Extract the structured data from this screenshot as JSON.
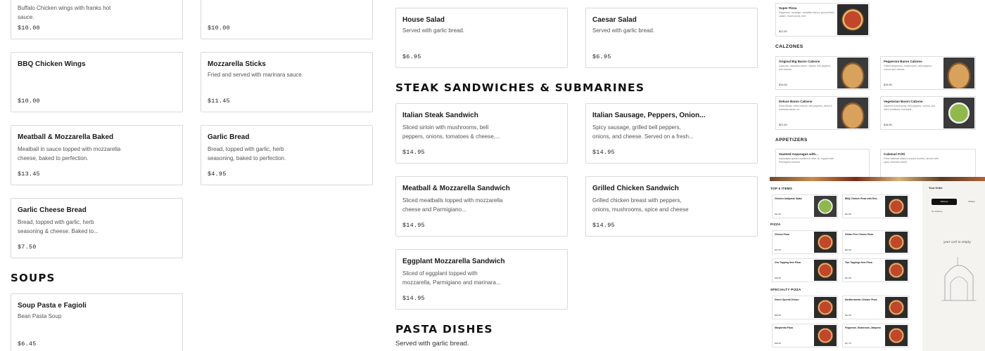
{
  "col1": {
    "cards": [
      {
        "name": "",
        "desc": "Buffalo Chicken wings with franks hot sauce.",
        "price": "$10.00"
      },
      {
        "name": "BBQ Chicken Wings",
        "desc": "",
        "price": "$10.00"
      },
      {
        "name": "Meatball & Mozzarella Baked",
        "desc": "Meatball in sauce topped with mozzarella cheese, baked to perfection.",
        "price": "$13.45"
      },
      {
        "name": "Garlic Cheese Bread",
        "desc": "Bread, topped with garlic, herb seasoning & cheese. Baked to...",
        "price": "$7.50"
      },
      {
        "name": "Soup Pasta e Fagioli",
        "desc": "Bean Pasta Soup",
        "price": "$6.45"
      }
    ],
    "soups_title": "SOUPS"
  },
  "col2": {
    "cards": [
      {
        "name": "",
        "desc": "",
        "price": "$10.00"
      },
      {
        "name": "Mozzarella Sticks",
        "desc": "Fried and served with marinara sauce.",
        "price": "$11.45"
      },
      {
        "name": "Garlic Bread",
        "desc": "Bread, topped with garlic, herb seasoning, baked to perfection.",
        "price": "$4.95"
      }
    ]
  },
  "col3": {
    "cards": [
      {
        "name": "House Salad",
        "desc": "Served with garlic bread.",
        "price": "$6.95"
      },
      {
        "name": "Italian Steak Sandwich",
        "desc": "Sliced sirloin with mushrooms, bell peppers, onions, tomatoes & cheese,...",
        "price": "$14.95"
      },
      {
        "name": "Meatball & Mozzarella Sandwich",
        "desc": "Sliced meatballs topped with mozzarella cheese and Parmigiano...",
        "price": "$14.95"
      },
      {
        "name": "Eggplant Mozzarella Sandwich",
        "desc": "Sliced of eggplant topped with mozzarella, Parmigiano and marinara...",
        "price": "$14.95"
      }
    ],
    "steak_title": "STEAK SANDWICHES & SUBMARINES",
    "pasta_title": "PASTA DISHES",
    "pasta_sub": "Served with garlic bread."
  },
  "col4": {
    "cards": [
      {
        "name": "Caesar Salad",
        "desc": "Served with garlic bread.",
        "price": "$6.95"
      },
      {
        "name": "Italian Sausage, Peppers, Onion...",
        "desc": "Spicy sausage, grilled bell peppers, onions, and cheese. Served on a fresh...",
        "price": "$14.95"
      },
      {
        "name": "Grilled Chicken Sandwich",
        "desc": "Grilled chicken breast with peppers, onions, mushrooms, spice and cheese",
        "price": "$14.95"
      }
    ]
  },
  "thumb_top": {
    "super": {
      "name": "Super Pizza",
      "desc": "Pepperoni, sausage, canadian bacon, ground beef, salami, mushrooms, bell...",
      "price": "$21.50"
    },
    "calzones_title": "CALZONES",
    "calzones": [
      {
        "name": "Original Big Baron Calzone",
        "desc": "Capicola, canadian bacon, salami, bell peppers and cheese.",
        "price": "$19.95"
      },
      {
        "name": "Pepperoni Baron Calzone",
        "desc": "Grilled pepperoni, mushrooms, bell peppers, onions and cheese.",
        "price": "$19.95"
      },
      {
        "name": "Deluxe Baron Calzone",
        "desc": "Extra Meats, extra cheese, bell peppers, olives & marinara sauce on...",
        "price": "$21.45"
      },
      {
        "name": "Vegetarian Baron Calzone",
        "desc": "Sauteed mushrooms, bell peppers, onions, sun-dried tomatoes, mozzarel...",
        "price": "$18.95"
      }
    ],
    "appetizers_title": "APPETIZERS",
    "appetizers": [
      {
        "name": "Sauteed Asparagus with...",
        "desc": "Asparagus spears sauteed in olive oil, topped with Parmigiano cheese."
      },
      {
        "name": "Calamari Fritti",
        "desc": "Fried calamari strips in panko crumbs, served with spicy marinara sauce."
      }
    ]
  },
  "thumb_bottom": {
    "top5_title": "TOP 5 ITEMS",
    "pizza_title": "PIZZA",
    "specialty_title": "SPECIALTY PIZZA",
    "items": [
      {
        "name": "Chicken Antipasto Salad",
        "price": "$11.95"
      },
      {
        "name": "BBQ Chicken Pizza with Red...",
        "price": "$21.95"
      },
      {
        "name": "Cheese Pizza",
        "price": "$17.45"
      },
      {
        "name": "Gluten Free Cheese Pizza",
        "price": "$22.95"
      },
      {
        "name": "One Topping Item Pizza",
        "price": "$18.95"
      },
      {
        "name": "Two Toppings Item Pizza",
        "price": "$21.95"
      },
      {
        "name": "Gino's Special Deluxe",
        "price": "$25.95"
      },
      {
        "name": "Mediterranean Chicken Pizza",
        "price": "$22.95"
      },
      {
        "name": "Margherita Pizza",
        "price": "$18.95"
      },
      {
        "name": "Pepperoni, Mushroom, Jalapeno",
        "price": "$17.75"
      }
    ],
    "order_title": "Your Order",
    "delivery_label": "Delivery",
    "pickup_label": "Pickup",
    "address_label": "No address",
    "empty_cart": "your cart is empty"
  }
}
